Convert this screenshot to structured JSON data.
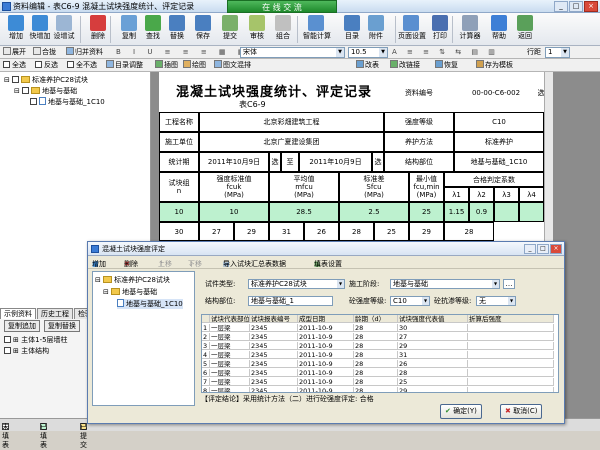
{
  "window": {
    "title": "资料编辑 - 表C6-9 混凝土试块强度统计、评定记录",
    "online_badge": "在 线 交 流",
    "controls": [
      "_",
      "□",
      "×"
    ]
  },
  "ribbon": {
    "buttons": [
      {
        "label": "增加",
        "color": "#3d8bd6"
      },
      {
        "label": "快增加",
        "color": "#3d8bd6"
      },
      {
        "label": "设增试",
        "color": "#9cb6d4"
      },
      {
        "label": "删除",
        "color": "#d63d3d"
      },
      {
        "label": "复制",
        "color": "#6aa0d6"
      },
      {
        "label": "查找",
        "color": "#4aa84a"
      },
      {
        "label": "替换",
        "color": "#4a7fc0"
      },
      {
        "label": "保存",
        "color": "#4a7fc0"
      },
      {
        "label": "提交",
        "color": "#7ab06a"
      },
      {
        "label": "审核",
        "color": "#a6c46a"
      },
      {
        "label": "组合",
        "color": "#c0c0c0"
      },
      {
        "label": "智能计算",
        "color": "#5a90d0"
      },
      {
        "label": "目录",
        "color": "#4a7fc0"
      },
      {
        "label": "附件",
        "color": "#6a9fd0"
      },
      {
        "label": "页面设置",
        "color": "#5a8fd0"
      },
      {
        "label": "打印",
        "color": "#4a6fb0"
      },
      {
        "label": "计算器",
        "color": "#8fa0b8"
      },
      {
        "label": "帮助",
        "color": "#3d7fd6"
      },
      {
        "label": "返回",
        "color": "#5aa05a"
      }
    ]
  },
  "toolbar2": {
    "items": [
      "展开",
      "合拢",
      "归并资料",
      "宋体",
      "10.5",
      "行距"
    ],
    "font": "宋体",
    "size": "10.5",
    "line_value": "1"
  },
  "toolbar3": {
    "items": [
      "全选",
      "反选",
      "全不选",
      "目录调整",
      "插图",
      "绘图",
      "图文混排",
      "改表",
      "改链接",
      "恢复",
      "存为模板"
    ]
  },
  "tree": {
    "root": "标准养护C28试块",
    "child": "地基与基础",
    "leaf": "地基与基础_1C10"
  },
  "left_bottom": {
    "tabs": [
      "示例资料",
      "历史工程",
      "检验"
    ],
    "buttons": [
      "复制追加",
      "复制替换"
    ],
    "items": [
      "主体1-5层墙柱",
      "主体结构"
    ]
  },
  "status": {
    "items": [
      "未填表",
      "已填表",
      "已提交"
    ]
  },
  "sheet": {
    "title": "混凝土试块强度统计、评定记录",
    "subtitle": "表C6-9",
    "doc_no_label": "资料编号",
    "doc_no": "00-00-C6-002",
    "side_char": "选",
    "project_label": "工程名称",
    "project": "北京彩畑建筑工程",
    "grade_label": "强度等级",
    "grade": "C10",
    "unit_label": "施工单位",
    "unit": "北京广夏建设集团",
    "cure_label": "养护方法",
    "cure": "标准养护",
    "period_label": "统计期",
    "period_from": "2011年10月9日",
    "period_to_label": "至",
    "period_to": "2011年10月9日",
    "part_label": "结构部位",
    "part": "地基与基础_1C10",
    "head_count": "试块组\nn",
    "head_std": "强度标准值\nfcuk\n(MPa)",
    "head_mean": "平均值\nmfcu\n(MPa)",
    "head_sd": "标准差\nSfcu\n(MPa)",
    "head_min": "最小值\nfcu,min\n(MPa)",
    "head_coef": "合格判定系数",
    "lambda": [
      "λ1",
      "λ2",
      "λ3",
      "λ4"
    ],
    "row1": [
      "10",
      "10",
      "28.5",
      "2.5",
      "25",
      "1.15",
      "0.9",
      "",
      ""
    ],
    "row2": [
      "30",
      "27",
      "29",
      "31",
      "26",
      "28",
      "25",
      "29",
      "28"
    ]
  },
  "dialog": {
    "title": "混凝土试块强度评定",
    "toolbar": [
      "增加",
      "删除",
      "上移",
      "下移",
      "导入试块汇总表数据",
      "填表设置"
    ],
    "tree_root": "标准养护C28试块",
    "tree_child": "地基与基础",
    "tree_leaf": "地基与基础_1C10",
    "type_label": "试件类型:",
    "type_value": "标准养护C28试块",
    "stage_label": "施工阶段:",
    "stage_value": "地基与基础",
    "part_label": "结构部位:",
    "part_value": "地基与基础_1",
    "grade_label": "砼强度等级:",
    "grade_value": "C10",
    "anti_label": "砼抗渗等级:",
    "anti_value": "无",
    "columns": [
      "",
      "试块代表部位",
      "试块报表编号",
      "成型日期",
      "龄期（d）",
      "试块强度代表值",
      "折算后强度"
    ],
    "rows": [
      [
        "1",
        "一层梁",
        "2345",
        "2011-10-9",
        "28",
        "30",
        ""
      ],
      [
        "2",
        "一层梁",
        "2345",
        "2011-10-9",
        "28",
        "27",
        ""
      ],
      [
        "3",
        "一层梁",
        "2345",
        "2011-10-9",
        "28",
        "29",
        ""
      ],
      [
        "4",
        "一层梁",
        "2345",
        "2011-10-9",
        "28",
        "31",
        ""
      ],
      [
        "5",
        "一层梁",
        "2345",
        "2011-10-9",
        "28",
        "26",
        ""
      ],
      [
        "6",
        "一层梁",
        "2345",
        "2011-10-9",
        "28",
        "28",
        ""
      ],
      [
        "7",
        "一层梁",
        "2345",
        "2011-10-9",
        "28",
        "25",
        ""
      ],
      [
        "8",
        "一层梁",
        "2345",
        "2011-10-9",
        "28",
        "29",
        ""
      ]
    ],
    "conclusion": "【评定结论】采用统计方法（二）进行砼强度评定: 合格",
    "ok": "确定(Y)",
    "cancel": "取消(C)"
  }
}
